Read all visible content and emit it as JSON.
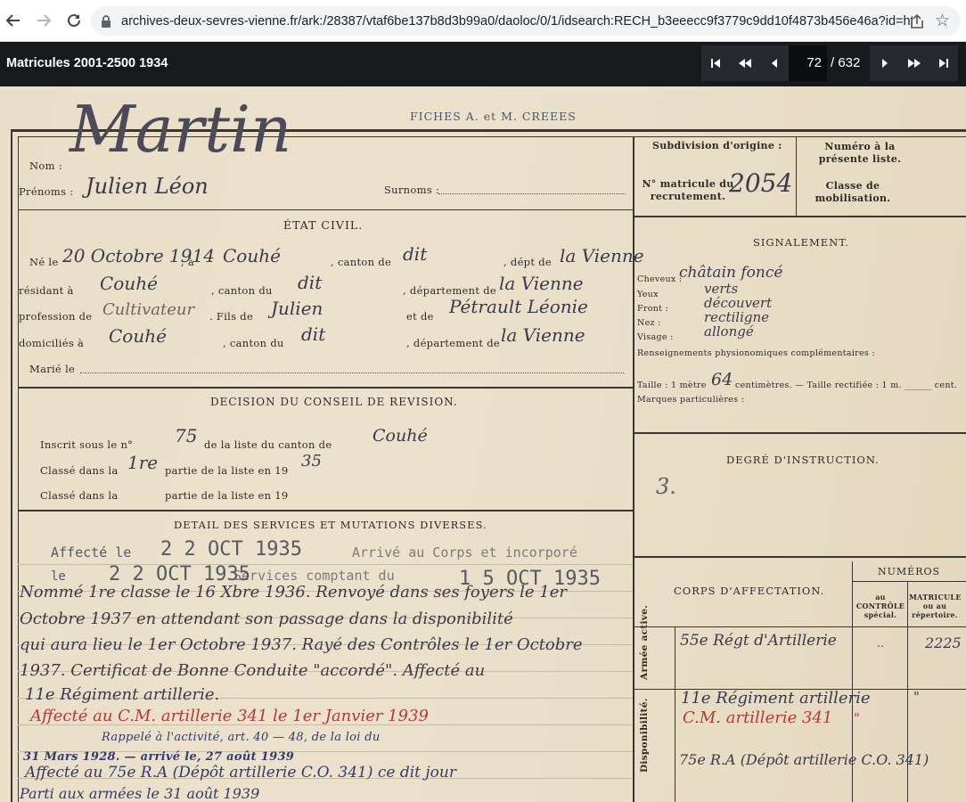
{
  "browser": {
    "url": "archives-deux-sevres-vienne.fr/ark:/28387/vtaf6be137b8d3b99a0/daoloc/0/1/idsearch:RECH_b3eeecc9f3779c9dd10f4873b456e46a?id=https%3..."
  },
  "viewer": {
    "title": "Matricules 2001-2500 1934",
    "current_page": "72",
    "total_pages": "/ 632"
  },
  "document": {
    "header_note": "FICHES A. et M. CREEES",
    "identity": {
      "nom_label": "Nom :",
      "nom_value": "Martin",
      "prenoms_label": "Prénoms :",
      "prenoms_value": "Julien Léon",
      "surnoms_label": "Surnoms :",
      "subdivision_label": "Subdivision d'origine :",
      "numero_liste_label": "Numéro à la présente liste.",
      "matricule_label": "N° matricule du recrutement.",
      "matricule_value": "2054",
      "classe_mob_label": "Classe de mobilisation."
    },
    "etat_civil": {
      "heading": "ÉTAT CIVIL.",
      "ne_le_label": "Né le",
      "ne_le_value": "20 Octobre 1914",
      "a_label": ", à",
      "birth_place": "Couhé",
      "canton_de_label": ", canton de",
      "canton_dit": "dit",
      "dept_de_label": ", dépt de",
      "dept_value": "la Vienne",
      "residant_label": "résidant à",
      "residant_value": "Couhé",
      "canton_du_label": ", canton du",
      "departement_de_label": ", département de",
      "profession_label": "profession de",
      "profession_value": "Cultivateur",
      "fils_de_label": ". Fils de",
      "father_value": "Julien",
      "et_de_label": "et de",
      "mother_value": "Pétrault Léonie",
      "domicilies_label": "domiciliés à",
      "domicilies_value": "Couhé",
      "marie_label": "Marié le"
    },
    "signalement": {
      "heading": "SIGNALEMENT.",
      "cheveux_label": "Cheveux :",
      "cheveux_value": "châtain foncé",
      "yeux_label": "Yeux",
      "yeux_value": "verts",
      "front_label": "Front :",
      "front_value": "découvert",
      "nez_label": "Nez :",
      "nez_value": "rectiligne",
      "visage_label": "Visage :",
      "visage_value": "allongé",
      "renseignements_label": "Renseignements physionomiques complémentaires :",
      "taille_label": "Taille : 1 mètre",
      "taille_value": "64",
      "taille_suffix": "centimètres. — Taille rectifiée : 1 m. ______ cent.",
      "marques_label": "Marques particulières :"
    },
    "conseil_revision": {
      "heading": "DECISION DU CONSEIL DE REVISION.",
      "inscrit_label": "Inscrit sous le n°",
      "inscrit_value": "75",
      "inscrit_suffix": "de la liste du canton de",
      "inscrit_canton": "Couhé",
      "classe1_label": "Classé dans la",
      "classe1_value": "1re",
      "partie_label": "partie de la liste en 19",
      "classe1_year": "35",
      "classe2_label": "Classé dans la",
      "partie2_label": "partie de la liste en 19"
    },
    "degre_instruction": {
      "heading": "DEGRÉ D'INSTRUCTION.",
      "value": "3."
    },
    "services": {
      "heading": "DETAIL DES SERVICES ET MUTATIONS DIVERSES.",
      "stamp1_prefix": "Affecté le",
      "stamp1_date": "2 2 OCT 1935",
      "stamp1_suffix": "Arrivé au Corps et incorporé",
      "stamp2_prefix": "le",
      "stamp2_date": "2 2 OCT 1935",
      "stamp2_mid": "Services comptant du",
      "stamp2_date2": "1 5 OCT 1935",
      "hand_line1": "Nommé 1re classe le 16 Xbre 1936. Renvoyé dans ses foyers le 1er",
      "hand_line2": "Octobre 1937 en attendant son passage dans la disponibilité",
      "hand_line3": "qui aura lieu le 1er Octobre 1937. Rayé des Contrôles le 1er Octobre",
      "hand_line4": "1937. Certificat de Bonne Conduite \"accordé\". Affecté au",
      "hand_line5": "11e Régiment artillerie.",
      "red_line": "Affecté au C.M. artillerie 341 le 1er Janvier 1939",
      "rappele_line": "Rappelé à l'activité, art. 40 — 48, de la loi du",
      "date31": "31 Mars 1928. — arrivé le, 27 août 1939",
      "affecte_line": "Affecté au 75e R.A (Dépôt artillerie C.O. 341) ce dit jour",
      "parti_line": "Parti aux armées le 31 août 1939"
    },
    "affectation": {
      "corps_heading": "CORPS D'AFFECTATION.",
      "numeros_heading": "NUMÉROS",
      "col_controle": "au CONTRÔLE spécial.",
      "col_matricule": "MATRICULE ou au répertoire.",
      "armee_active_label": "Armée active.",
      "disponibilite_label": "Disponibilité.",
      "active_value": "55e Régt d'Artillerie",
      "active_controle": "..",
      "active_matricule": "2225",
      "dispo_value1": "11e Régiment artillerie",
      "dispo_value1_mark": "\"",
      "dispo_value2": "C.M. artillerie 341",
      "dispo_value2_mark": "\"",
      "dispo_value3": "75e R.A (Dépôt artillerie C.O. 341)"
    }
  }
}
